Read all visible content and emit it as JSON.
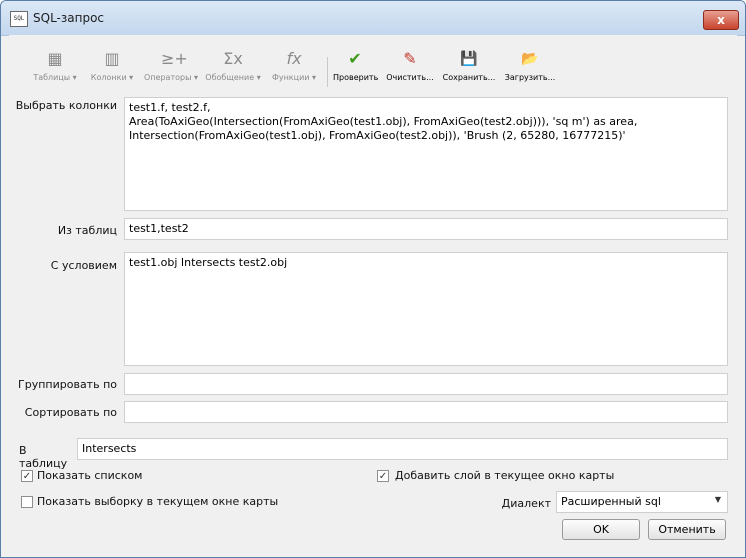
{
  "window": {
    "title": "SQL-запрос",
    "icon_text": "SQL",
    "close": "x"
  },
  "toolbar": {
    "tables": {
      "label": "Таблицы ▾",
      "icon": "▦"
    },
    "columns": {
      "label": "Колонки ▾",
      "icon": "▥"
    },
    "operators": {
      "label": "Операторы ▾",
      "icon": "≥+"
    },
    "aggregate": {
      "label": "Обобщение ▾",
      "icon": "Σx"
    },
    "functions": {
      "label": "Функции ▾",
      "icon": "fx"
    },
    "check": {
      "label": "Проверить",
      "icon": "✔"
    },
    "clear": {
      "label": "Очистить...",
      "icon": "✎"
    },
    "save": {
      "label": "Сохранить...",
      "icon": "💾"
    },
    "load": {
      "label": "Загрузить...",
      "icon": "📂"
    }
  },
  "form": {
    "select_label": "Выбрать колонки",
    "select_value": "test1.f, test2.f,\nArea(ToAxiGeo(Intersection(FromAxiGeo(test1.obj), FromAxiGeo(test2.obj))), 'sq m') as area,\nIntersection(FromAxiGeo(test1.obj), FromAxiGeo(test2.obj)), 'Brush (2, 65280, 16777215)'",
    "from_label": "Из таблиц",
    "from_value": "test1,test2",
    "where_label": "С условием",
    "where_value": "test1.obj Intersects test2.obj",
    "group_label": "Группировать по",
    "group_value": "",
    "order_label": "Сортировать по",
    "order_value": "",
    "into_label": "В таблицу",
    "into_value": "Intersects"
  },
  "options": {
    "show_list": {
      "label": "Показать списком",
      "checked": "✓"
    },
    "add_layer": {
      "label": "Добавить слой в текущее окно карты",
      "checked": "✓"
    },
    "show_selection": {
      "label": "Показать выборку в текущем окне карты",
      "checked": ""
    },
    "dialect_label": "Диалект",
    "dialect_value": "Расширенный sql",
    "dialect_caret": "▼"
  },
  "buttons": {
    "ok": "OK",
    "cancel": "Отменить"
  },
  "colors": {
    "check_green": "#3f9a1c",
    "disabled_gray": "#8b8b8b"
  }
}
